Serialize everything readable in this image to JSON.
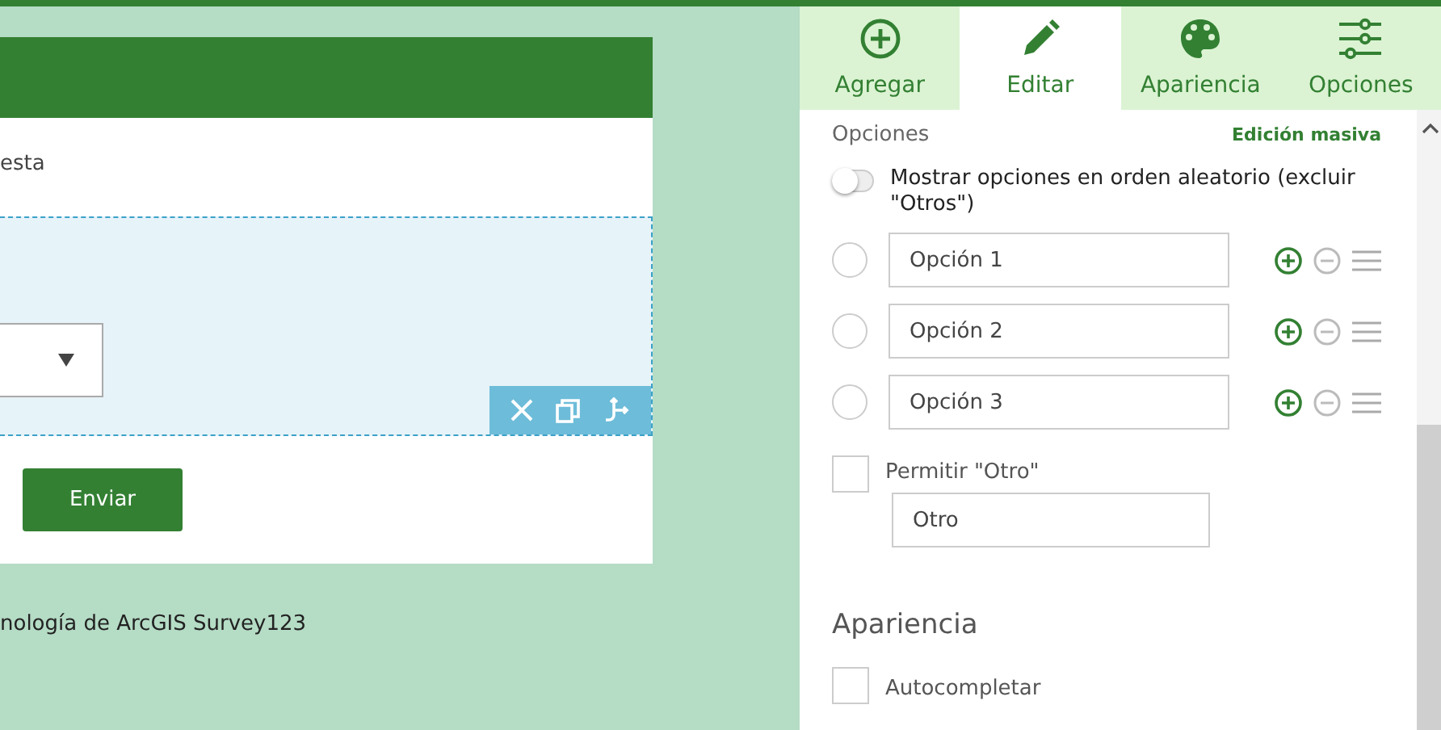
{
  "form": {
    "body_text": "esta",
    "submit": "Enviar",
    "footer": "nología de ArcGIS Survey123"
  },
  "tabs": [
    {
      "label": "Agregar",
      "selected": false
    },
    {
      "label": "Editar",
      "selected": true
    },
    {
      "label": "Apariencia",
      "selected": false
    },
    {
      "label": "Opciones",
      "selected": false
    }
  ],
  "options_section": {
    "title": "Opciones",
    "bulk_edit": "Edición masiva",
    "random_order": {
      "label": "Mostrar opciones en orden aleatorio (excluir \"Otros\")",
      "on": false
    },
    "choices": [
      {
        "value": "Opción 1",
        "selected": false
      },
      {
        "value": "Opción 2",
        "selected": false
      },
      {
        "value": "Opción 3",
        "selected": false
      }
    ],
    "allow_other": {
      "label": "Permitir \"Otro\"",
      "checked": false,
      "value": "Otro"
    }
  },
  "appearance": {
    "title": "Apariencia",
    "autocomplete": {
      "label": "Autocompletar",
      "checked": false
    }
  }
}
